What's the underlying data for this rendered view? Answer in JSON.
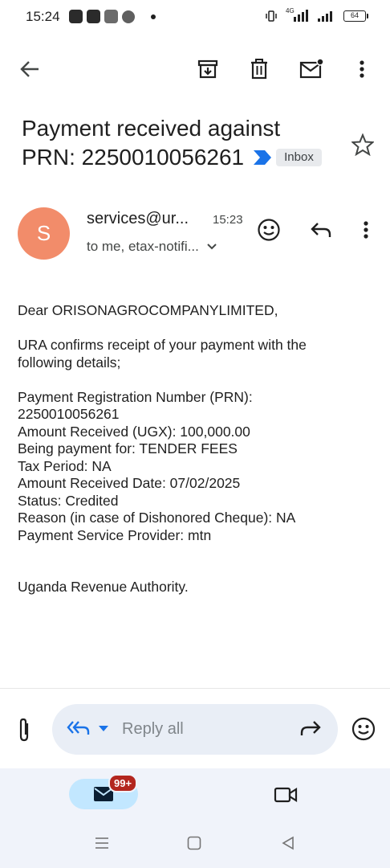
{
  "status_bar": {
    "time": "15:24",
    "network_label": "4G",
    "battery": "64"
  },
  "toolbar": {
    "back_icon": "arrow-back-icon",
    "archive_icon": "archive-icon",
    "delete_icon": "trash-icon",
    "mark_unread_icon": "mark-unread-icon",
    "more_icon": "more-vert-icon"
  },
  "subject": {
    "line1": "Payment received against",
    "line2": "PRN: 2250010056261",
    "label": "Inbox"
  },
  "sender": {
    "avatar_letter": "S",
    "avatar_color": "#f28c6a",
    "name": "services@ur...",
    "time": "15:23",
    "recipients": "to me, etax-notifi..."
  },
  "body": {
    "greeting": "Dear ORISONAGROCOMPANYLIMITED,",
    "intro_1": "URA confirms receipt of your payment with the",
    "intro_2": "following details;",
    "details": [
      "Payment Registration Number (PRN):",
      "2250010056261",
      "Amount Received (UGX): 100,000.00",
      "Being payment for: TENDER FEES",
      "Tax Period: NA",
      "Amount Received Date: 07/02/2025",
      "Status: Credited",
      "Reason (in case of Dishonored Cheque): NA",
      "Payment Service Provider: mtn"
    ],
    "signature": "Uganda Revenue Authority."
  },
  "reply_bar": {
    "reply_label": "Reply all"
  },
  "bottom_nav": {
    "mail_badge": "99+"
  },
  "colors": {
    "accent_blue": "#1a73e8",
    "pill_bg": "#e9eef6",
    "nav_active": "#c2e7ff",
    "badge_red": "#b3261e"
  }
}
